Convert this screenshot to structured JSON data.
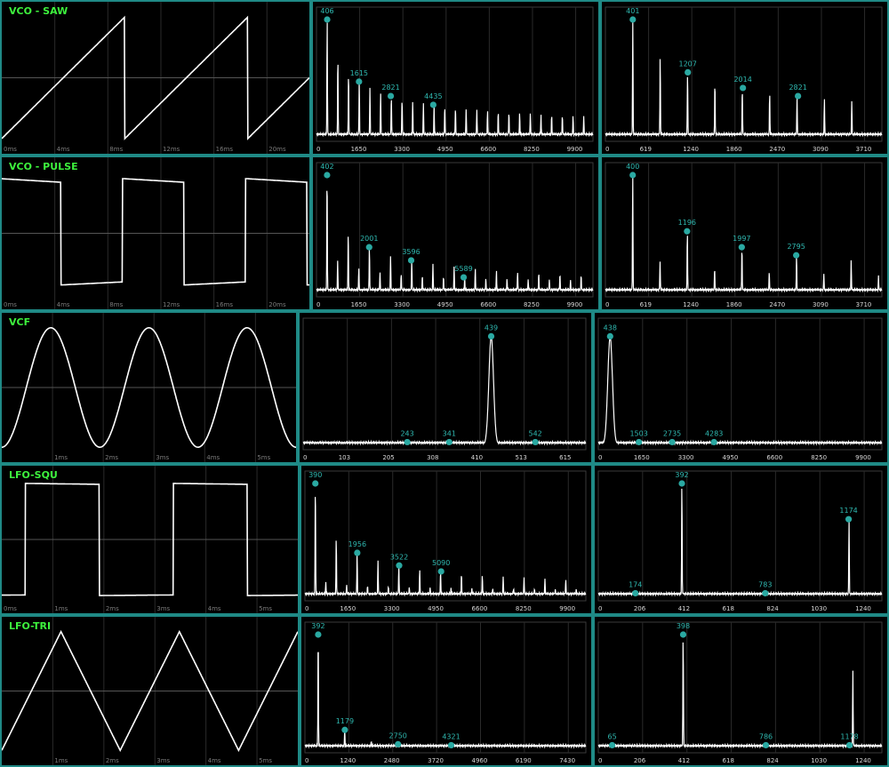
{
  "colors": {
    "frame": "#1f8a86",
    "title": "#3df23d",
    "marker": "#2aa9a2",
    "trace": "#ffffff",
    "grid": "#2a2a2a"
  },
  "rows": [
    {
      "title": "VCO - SAW",
      "scope": {
        "wave": "saw",
        "ticks": [
          "0ms",
          "4ms",
          "8ms",
          "12ms",
          "16ms",
          "20ms"
        ],
        "periods": 2.5
      },
      "spec1": {
        "ticks": [
          "0",
          "1650",
          "3300",
          "4950",
          "6600",
          "8250",
          "9900"
        ],
        "xmax": 10500,
        "harm": "saw",
        "f0": 406,
        "peaks": [
          {
            "f": 406,
            "label": "406"
          },
          {
            "f": 1615,
            "label": "1615"
          },
          {
            "f": 2821,
            "label": "2821"
          },
          {
            "f": 4435,
            "label": "4435"
          }
        ]
      },
      "spec2": {
        "ticks": [
          "0",
          "619",
          "1240",
          "1860",
          "2470",
          "3090",
          "3710"
        ],
        "xmax": 4050,
        "harm": "saw",
        "f0": 401,
        "peaks": [
          {
            "f": 401,
            "label": "401"
          },
          {
            "f": 1207,
            "label": "1207"
          },
          {
            "f": 2014,
            "label": "2014"
          },
          {
            "f": 2821,
            "label": "2821"
          }
        ]
      }
    },
    {
      "title": "VCO - PULSE",
      "scope": {
        "wave": "pulse",
        "ticks": [
          "0ms",
          "4ms",
          "8ms",
          "12ms",
          "16ms",
          "20ms"
        ],
        "periods": 2.5
      },
      "spec1": {
        "ticks": [
          "0",
          "1650",
          "3300",
          "4950",
          "6600",
          "8250",
          "9900"
        ],
        "xmax": 10500,
        "harm": "pulse",
        "f0": 402,
        "peaks": [
          {
            "f": 402,
            "label": "402"
          },
          {
            "f": 2001,
            "label": "2001"
          },
          {
            "f": 3596,
            "label": "3596"
          },
          {
            "f": 5589,
            "label": "5589"
          }
        ]
      },
      "spec2": {
        "ticks": [
          "0",
          "619",
          "1240",
          "1860",
          "2470",
          "3090",
          "3710"
        ],
        "xmax": 4050,
        "harm": "pulse",
        "f0": 400,
        "peaks": [
          {
            "f": 400,
            "label": "400"
          },
          {
            "f": 1196,
            "label": "1196"
          },
          {
            "f": 1997,
            "label": "1997"
          },
          {
            "f": 2795,
            "label": "2795"
          }
        ]
      }
    },
    {
      "title": "VCF",
      "scope": {
        "wave": "sine",
        "ticks": [
          "",
          "1ms",
          "2ms",
          "3ms",
          "4ms",
          "5ms"
        ],
        "periods": 3
      },
      "spec1": {
        "ticks": [
          "0",
          "103",
          "205",
          "308",
          "410",
          "513",
          "615"
        ],
        "xmax": 660,
        "harm": "single",
        "f0": 439,
        "peaks": [
          {
            "f": 243,
            "label": "243"
          },
          {
            "f": 341,
            "label": "341"
          },
          {
            "f": 439,
            "label": "439"
          },
          {
            "f": 542,
            "label": "542"
          }
        ]
      },
      "spec2": {
        "ticks": [
          "0",
          "1650",
          "3300",
          "4950",
          "6600",
          "8250",
          "9900"
        ],
        "xmax": 10500,
        "harm": "single",
        "f0": 438,
        "peaks": [
          {
            "f": 438,
            "label": "438"
          },
          {
            "f": 1503,
            "label": "1503"
          },
          {
            "f": 2735,
            "label": "2735"
          },
          {
            "f": 4283,
            "label": "4283"
          }
        ]
      }
    },
    {
      "title": "LFO-SQU",
      "scope": {
        "wave": "square",
        "ticks": [
          "0ms",
          "1ms",
          "2ms",
          "3ms",
          "4ms",
          "5ms"
        ],
        "periods": 2
      },
      "spec1": {
        "ticks": [
          "0",
          "1650",
          "3300",
          "4950",
          "6600",
          "8250",
          "9900"
        ],
        "xmax": 10500,
        "harm": "square",
        "f0": 390,
        "peaks": [
          {
            "f": 390,
            "label": "390"
          },
          {
            "f": 1956,
            "label": "1956"
          },
          {
            "f": 3522,
            "label": "3522"
          },
          {
            "f": 5090,
            "label": "5090"
          }
        ]
      },
      "spec2": {
        "ticks": [
          "0",
          "206",
          "412",
          "618",
          "824",
          "1030",
          "1240"
        ],
        "xmax": 1330,
        "harm": "odd",
        "f0": 392,
        "peaks": [
          {
            "f": 174,
            "label": "174"
          },
          {
            "f": 392,
            "label": "392"
          },
          {
            "f": 783,
            "label": "783"
          },
          {
            "f": 1174,
            "label": "1174"
          }
        ]
      }
    },
    {
      "title": "LFO-TRI",
      "scope": {
        "wave": "tri",
        "ticks": [
          "",
          "1ms",
          "2ms",
          "3ms",
          "4ms",
          "5ms"
        ],
        "periods": 2.5
      },
      "spec1": {
        "ticks": [
          "0",
          "1240",
          "2480",
          "3720",
          "4960",
          "6190",
          "7430"
        ],
        "xmax": 8300,
        "harm": "tri",
        "f0": 392,
        "peaks": [
          {
            "f": 392,
            "label": "392"
          },
          {
            "f": 1179,
            "label": "1179"
          },
          {
            "f": 2750,
            "label": "2750"
          },
          {
            "f": 4321,
            "label": "4321"
          }
        ]
      },
      "spec2": {
        "ticks": [
          "0",
          "206",
          "412",
          "618",
          "824",
          "1030",
          "1240"
        ],
        "xmax": 1330,
        "harm": "odd",
        "f0": 398,
        "peaks": [
          {
            "f": 65,
            "label": "65"
          },
          {
            "f": 398,
            "label": "398"
          },
          {
            "f": 786,
            "label": "786"
          },
          {
            "f": 1178,
            "label": "1178"
          }
        ]
      }
    }
  ]
}
